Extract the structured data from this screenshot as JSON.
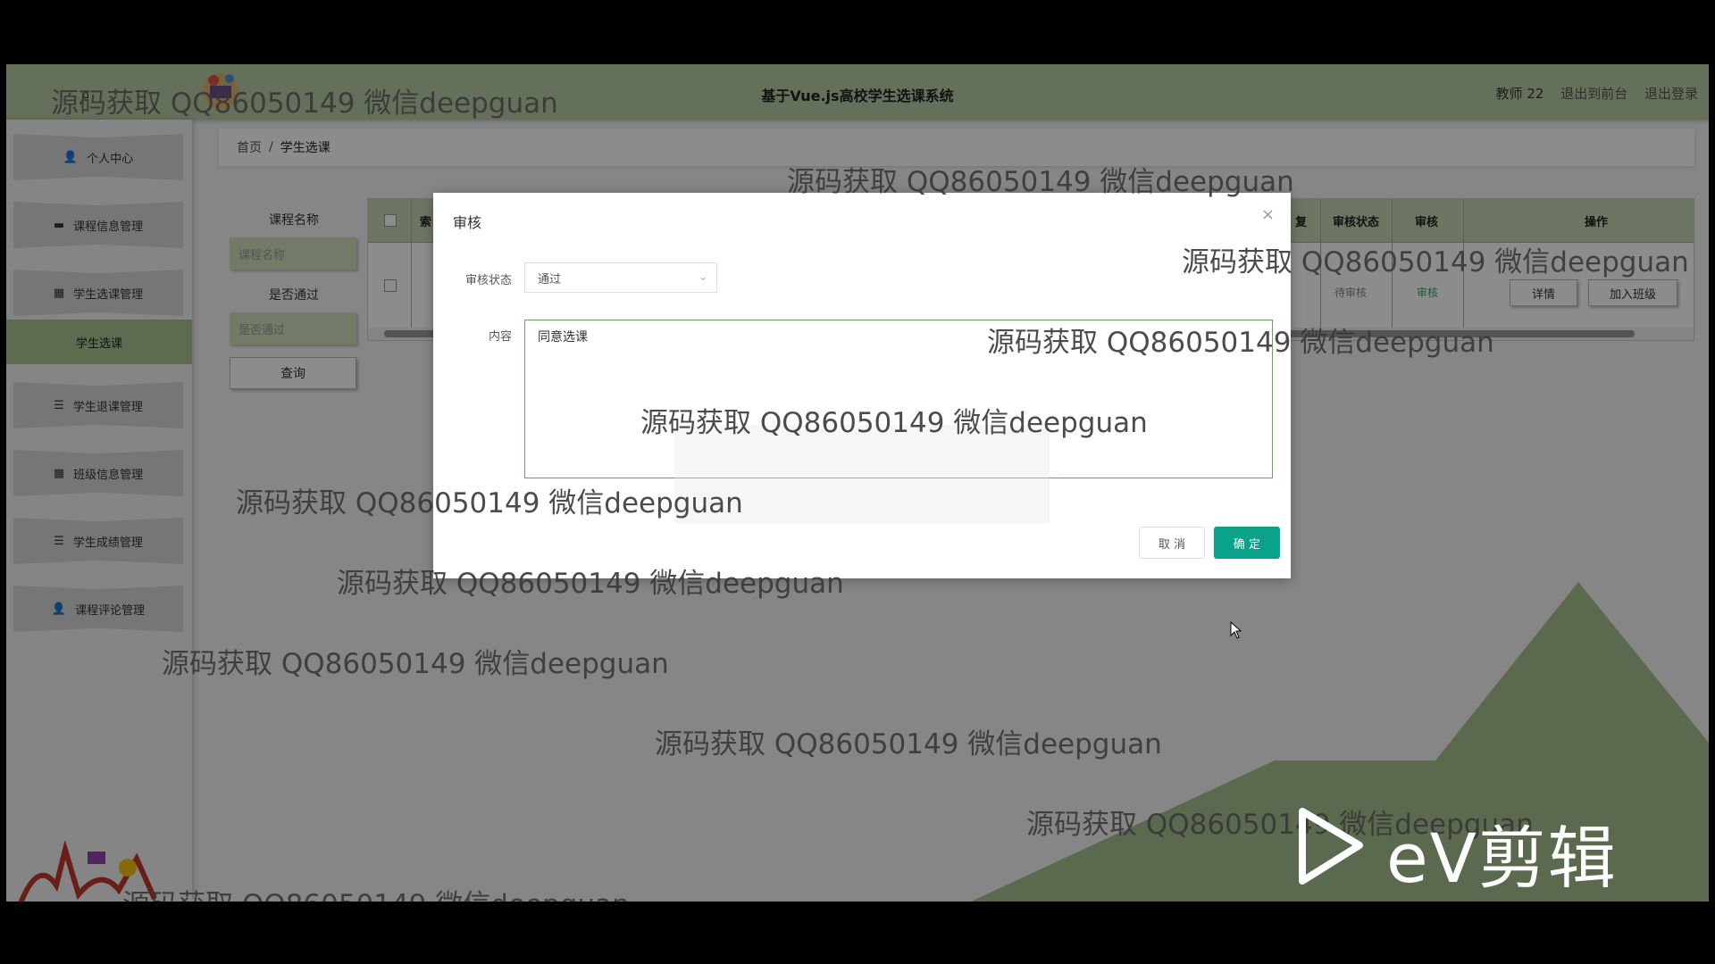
{
  "app": {
    "title": "基于Vue.js高校学生选课系统",
    "user": "教师 22",
    "exit_front": "退出到前台",
    "logout": "退出登录"
  },
  "sidebar": {
    "items": [
      {
        "label": "个人中心",
        "icon": "user-icon"
      },
      {
        "label": "课程信息管理",
        "icon": "monitor-icon"
      },
      {
        "label": "学生选课管理",
        "icon": "grid-icon"
      },
      {
        "label": "学生选课",
        "active": true
      },
      {
        "label": "学生退课管理",
        "icon": "list-icon"
      },
      {
        "label": "班级信息管理",
        "icon": "grid-icon"
      },
      {
        "label": "学生成绩管理",
        "icon": "list-icon"
      },
      {
        "label": "课程评论管理",
        "icon": "user-icon"
      }
    ]
  },
  "breadcrumb": {
    "home": "首页",
    "separator": "/",
    "current": "学生选课"
  },
  "search": {
    "course_label": "课程名称",
    "course_placeholder": "课程名称",
    "pass_label": "是否通过",
    "pass_placeholder": "是否通过",
    "query_label": "查询"
  },
  "table": {
    "headers": {
      "index": "索",
      "reply": "复",
      "audit_status": "审核状态",
      "audit": "审核",
      "ops": "操作"
    },
    "row": {
      "audit_status": "待审核",
      "audit_link": "审核",
      "detail": "详情",
      "join_class": "加入班级"
    }
  },
  "dialog": {
    "title": "审核",
    "close": "×",
    "status_label": "审核状态",
    "status_value": "通过",
    "content_label": "内容",
    "content_value": "同意选课",
    "cancel": "取 消",
    "confirm": "确 定"
  },
  "watermark": "源码获取 QQ86050149 微信deepguan",
  "ev_brand": "eV剪辑",
  "colors": {
    "accent_green": "#b9cda4",
    "confirm": "#0aa28a",
    "active_menu": "#a9c490"
  }
}
